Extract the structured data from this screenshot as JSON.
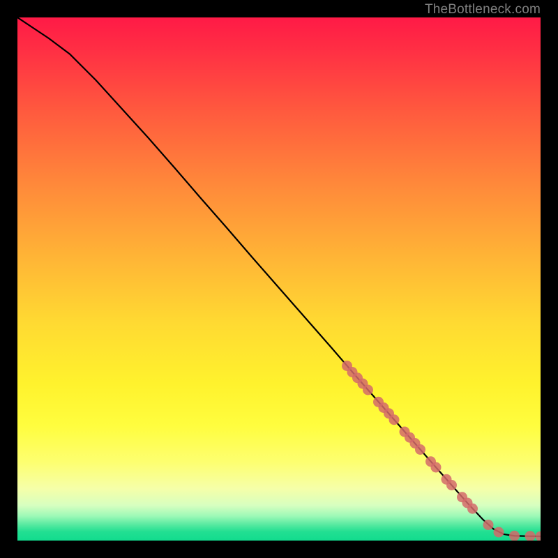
{
  "watermark": "TheBottleneck.com",
  "chart_data": {
    "type": "line",
    "title": "",
    "xlabel": "",
    "ylabel": "",
    "xlim": [
      0,
      100
    ],
    "ylim": [
      0,
      100
    ],
    "grid": false,
    "legend": false,
    "series": [
      {
        "name": "bottleneck-curve",
        "color": "#000000",
        "x": [
          0,
          3,
          6,
          10,
          15,
          20,
          25,
          30,
          35,
          40,
          45,
          50,
          55,
          60,
          65,
          70,
          75,
          80,
          83,
          86,
          89,
          91,
          93,
          95,
          97,
          100
        ],
        "y": [
          100,
          98,
          96,
          93,
          88,
          82.5,
          77,
          71.3,
          65.5,
          59.8,
          54,
          48.3,
          42.6,
          36.9,
          31.1,
          25.4,
          19.7,
          14,
          10.6,
          7.2,
          4.0,
          2.2,
          1.2,
          0.9,
          0.85,
          0.8
        ]
      }
    ],
    "markers": {
      "name": "highlighted-range",
      "color": "#d46a6a",
      "points_xy": [
        [
          63,
          33.4
        ],
        [
          64,
          32.2
        ],
        [
          65,
          31.1
        ],
        [
          66,
          30.0
        ],
        [
          67,
          28.8
        ],
        [
          69,
          26.5
        ],
        [
          70,
          25.4
        ],
        [
          71,
          24.3
        ],
        [
          72,
          23.1
        ],
        [
          74,
          20.8
        ],
        [
          75,
          19.7
        ],
        [
          76,
          18.6
        ],
        [
          77,
          17.4
        ],
        [
          79,
          15.1
        ],
        [
          80,
          14.0
        ],
        [
          82,
          11.7
        ],
        [
          83,
          10.6
        ],
        [
          85,
          8.3
        ],
        [
          86,
          7.2
        ],
        [
          87,
          6.1
        ],
        [
          90,
          3.0
        ],
        [
          92,
          1.6
        ],
        [
          95,
          0.9
        ],
        [
          98,
          0.85
        ],
        [
          100,
          0.8
        ]
      ]
    }
  }
}
